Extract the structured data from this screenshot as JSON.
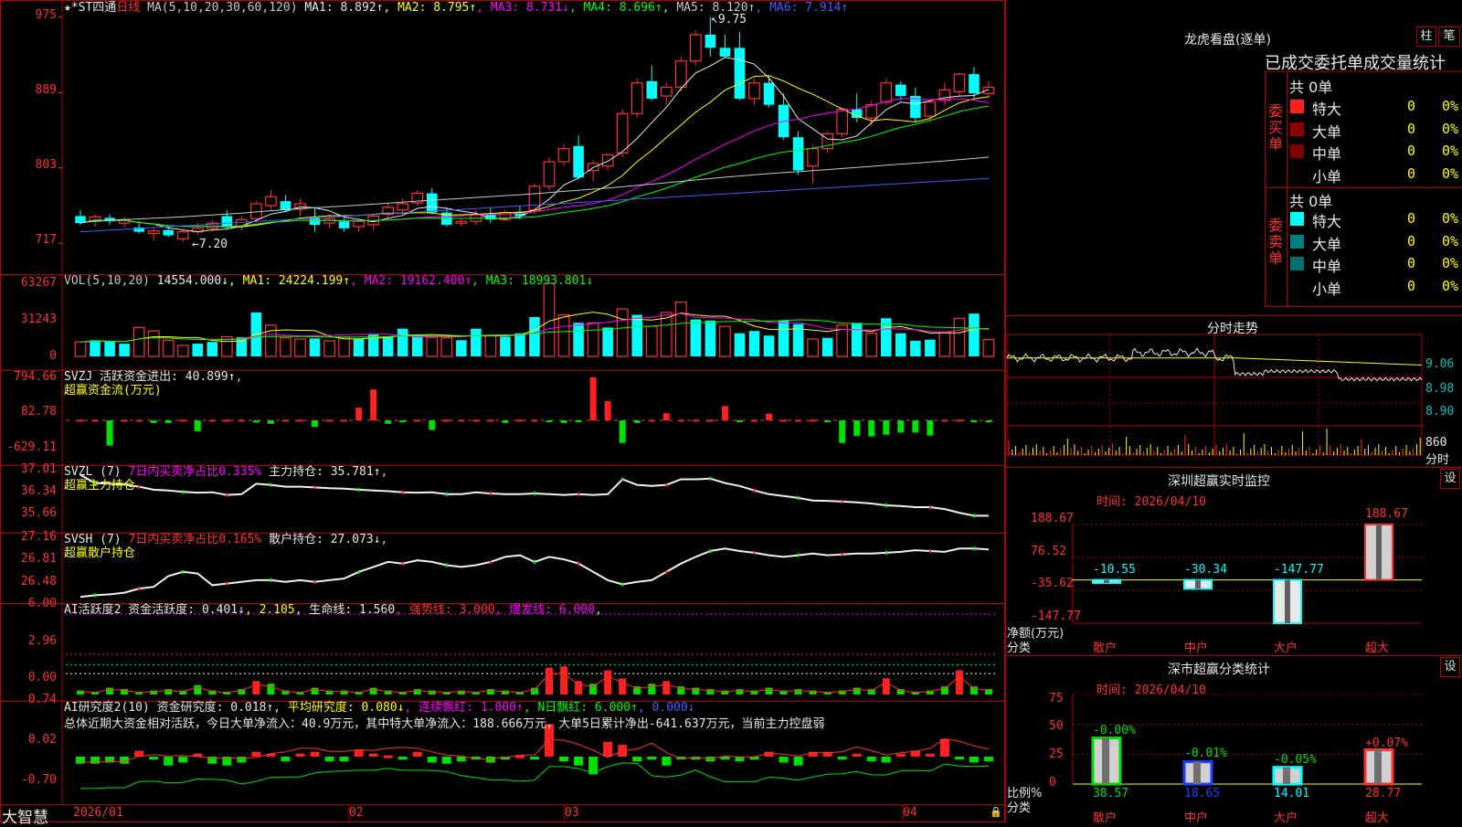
{
  "colors": {
    "up": "#ff3232",
    "down": "#00ffff",
    "border": "#b00000"
  },
  "price_panel": {
    "header": [
      {
        "t": "★*ST四通",
        "c": "#e8e8e8"
      },
      {
        "t": "日线",
        "c": "#ff3030"
      },
      {
        "t": " MA(5,10,20,30,60,120) ",
        "c": "#c8c8c8"
      },
      {
        "t": "MA1: 8.892↑",
        "c": "#e8e8e8"
      },
      {
        "t": ", MA2: 8.795↑",
        "c": "#ffff00"
      },
      {
        "t": ", MA3: 8.731↓",
        "c": "#ff00ff"
      },
      {
        "t": ", MA4: 8.696↑",
        "c": "#00ff00"
      },
      {
        "t": ", MA5: 8.120↑",
        "c": "#c8c8c8"
      },
      {
        "t": ", MA6: 7.914↑",
        "c": "#4060ff"
      }
    ],
    "y_labels": [
      "975",
      "889",
      "803",
      "717"
    ],
    "annot_high": "9.75",
    "annot_low": "7.20"
  },
  "vol_panel": {
    "header": [
      {
        "t": "VOL(5,10,20) ",
        "c": "#c8c8c8"
      },
      {
        "t": "14554.000↓",
        "c": "#e8e8e8"
      },
      {
        "t": ", MA1: 24224.199↑",
        "c": "#ffff00"
      },
      {
        "t": ", MA2: 19162.400↑",
        "c": "#ff00ff"
      },
      {
        "t": ", MA3: 18993.801↓",
        "c": "#00ff00"
      }
    ],
    "y_labels": [
      "63267",
      "31243",
      "0"
    ]
  },
  "svzj_panel": {
    "header": [
      {
        "t": "SVZJ  活跃资金进出: 40.899↑",
        "c": "#e8e8e8"
      },
      {
        "t": ",",
        "c": "#c8c8c8"
      }
    ],
    "subtitle": "超赢资金流(万元)",
    "y_labels": [
      "794.66",
      "82.78",
      "-629.11"
    ]
  },
  "svzl_panel": {
    "header": [
      {
        "t": "SVZL (7) ",
        "c": "#e8e8e8"
      },
      {
        "t": "7日内买卖净占比0.335%",
        "c": "#ff00ff"
      },
      {
        "t": " 主力持仓: 35.781↑",
        "c": "#e8e8e8"
      },
      {
        "t": ",",
        "c": "#c8c8c8"
      }
    ],
    "subtitle": "超赢主力持仓",
    "y_labels": [
      "37.01",
      "36.34",
      "35.66"
    ]
  },
  "svsh_panel": {
    "header": [
      {
        "t": "SVSH (7) ",
        "c": "#e8e8e8"
      },
      {
        "t": "7日内买卖净占比0.165%",
        "c": "#ff3030"
      },
      {
        "t": " 散户持仓: 27.073↓",
        "c": "#e8e8e8"
      },
      {
        "t": ",",
        "c": "#c8c8c8"
      }
    ],
    "subtitle": "超赢散户持仓",
    "y_labels": [
      "27.16",
      "26.81",
      "26.48"
    ]
  },
  "ai_active_panel": {
    "header": [
      {
        "t": "AI活跃度2 资金活跃度: 0.401↓",
        "c": "#e8e8e8"
      },
      {
        "t": ", 2.105",
        "c": "#ffff00"
      },
      {
        "t": ", 生命线: 1.560",
        "c": "#e8e8e8"
      },
      {
        "t": ", 强势线: 3.000",
        "c": "#ff3030"
      },
      {
        "t": ", 爆发线: 6.000",
        "c": "#ff00ff"
      },
      {
        "t": ",",
        "c": "#c8c8c8"
      }
    ],
    "y_labels": [
      "6.00",
      "2.96",
      "0.00"
    ]
  },
  "ai_research_panel": {
    "header": [
      {
        "t": "AI研究度2(10) 资金研究度: 0.018↑",
        "c": "#e8e8e8"
      },
      {
        "t": ", 平均研究度: 0.080↓",
        "c": "#ffff00"
      },
      {
        "t": ", 连续飘红: 1.000↑",
        "c": "#ff00ff"
      },
      {
        "t": ", N日飘红: 6.000↑",
        "c": "#00ff00"
      },
      {
        "t": ", 0.000↓",
        "c": "#4060ff"
      }
    ],
    "summary": "总体近期大资金相对活跃，今日大单净流入：40.9万元，其中特大单净流入：188.666万元，大单5日累计净出-641.637万元，当前主力控盘弱",
    "y_labels": [
      "0.74",
      "0.02",
      "-0.70"
    ]
  },
  "bottom_bar": {
    "brand": "大智慧",
    "dates": [
      "2026/01",
      "02",
      "03",
      "04"
    ]
  },
  "side": {
    "lhb_title": "龙虎看盘(逐单)",
    "btn_zhu": "柱",
    "btn_bi": "笔",
    "stat_header": "已成交委托单成交量统计",
    "buy_label": "委买单",
    "sell_label": "委卖单",
    "buy_total": "共 0单",
    "sell_total": "共 0单",
    "buy_rows": [
      {
        "name": "特大",
        "n": "0",
        "p": "0%",
        "c": "#ff2020"
      },
      {
        "name": "大单",
        "n": "0",
        "p": "0%",
        "c": "#900000"
      },
      {
        "name": "中单",
        "n": "0",
        "p": "0%",
        "c": "#800000"
      },
      {
        "name": "小单",
        "n": "0",
        "p": "0%",
        "c": "#000000"
      }
    ],
    "sell_rows": [
      {
        "name": "特大",
        "n": "0",
        "p": "0%",
        "c": "#00ffff"
      },
      {
        "name": "大单",
        "n": "0",
        "p": "0%",
        "c": "#008080"
      },
      {
        "name": "中单",
        "n": "0",
        "p": "0%",
        "c": "#007070"
      },
      {
        "name": "小单",
        "n": "0",
        "p": "0%",
        "c": "#000000"
      }
    ],
    "intraday_title": "分时走势",
    "intraday_y": [
      "9.06",
      "8.98",
      "8.90"
    ],
    "intraday_vol_y": [
      "860",
      "分时"
    ],
    "sz_title": "深圳超赢实时监控",
    "sz_time": "时间: 2026/04/10",
    "sz_btn": "设",
    "sz_y": [
      "188.67",
      "76.52",
      "-35.62",
      "-147.77"
    ],
    "sz_unit_1": "净额(万元)",
    "sz_unit_2": "分类",
    "sz_cats": [
      "散户",
      "中户",
      "大户",
      "超大"
    ],
    "sz_values": [
      "-10.55",
      "-30.34",
      "-147.77",
      "188.67"
    ],
    "cls_title": "深市超赢分类统计",
    "cls_time": "时间: 2026/04/10",
    "cls_btn": "设",
    "cls_y": [
      "75",
      "50",
      "25",
      "0"
    ],
    "cls_unit_1": "比例%",
    "cls_unit_2": "分类",
    "cls_cats": [
      "散户",
      "中户",
      "大户",
      "超大"
    ],
    "cls_top": [
      "-0.00%",
      "-0.01%",
      "-0.05%",
      "+0.07%"
    ],
    "cls_bottom": [
      "38.57",
      "18.65",
      "14.01",
      "28.77"
    ]
  },
  "chart_data": {
    "type": "candlestick",
    "title": "★*ST四通 日线",
    "x_labels": [
      "2026/01",
      "02",
      "03",
      "04"
    ],
    "ylim": [
      7.13,
      9.8
    ],
    "ohlc": [
      [
        7.48,
        7.55,
        7.38,
        7.4
      ],
      [
        7.42,
        7.5,
        7.36,
        7.47
      ],
      [
        7.46,
        7.5,
        7.38,
        7.42
      ],
      [
        7.4,
        7.47,
        7.35,
        7.44
      ],
      [
        7.35,
        7.42,
        7.28,
        7.3
      ],
      [
        7.28,
        7.34,
        7.2,
        7.31
      ],
      [
        7.32,
        7.36,
        7.24,
        7.26
      ],
      [
        7.22,
        7.32,
        7.18,
        7.3
      ],
      [
        7.3,
        7.4,
        7.26,
        7.34
      ],
      [
        7.34,
        7.44,
        7.3,
        7.4
      ],
      [
        7.48,
        7.55,
        7.33,
        7.35
      ],
      [
        7.36,
        7.48,
        7.32,
        7.44
      ],
      [
        7.45,
        7.65,
        7.42,
        7.62
      ],
      [
        7.6,
        7.78,
        7.55,
        7.7
      ],
      [
        7.65,
        7.72,
        7.52,
        7.55
      ],
      [
        7.56,
        7.68,
        7.48,
        7.62
      ],
      [
        7.46,
        7.58,
        7.3,
        7.38
      ],
      [
        7.4,
        7.5,
        7.34,
        7.45
      ],
      [
        7.42,
        7.48,
        7.3,
        7.34
      ],
      [
        7.36,
        7.45,
        7.3,
        7.42
      ],
      [
        7.38,
        7.5,
        7.32,
        7.48
      ],
      [
        7.5,
        7.62,
        7.46,
        7.58
      ],
      [
        7.55,
        7.68,
        7.5,
        7.62
      ],
      [
        7.63,
        7.78,
        7.6,
        7.74
      ],
      [
        7.74,
        7.8,
        7.5,
        7.52
      ],
      [
        7.52,
        7.58,
        7.36,
        7.38
      ],
      [
        7.4,
        7.45,
        7.36,
        7.42
      ],
      [
        7.42,
        7.55,
        7.38,
        7.5
      ],
      [
        7.5,
        7.58,
        7.4,
        7.44
      ],
      [
        7.44,
        7.55,
        7.42,
        7.52
      ],
      [
        7.53,
        7.6,
        7.44,
        7.48
      ],
      [
        7.55,
        7.85,
        7.5,
        7.82
      ],
      [
        7.82,
        8.15,
        7.78,
        8.1
      ],
      [
        8.1,
        8.3,
        8.05,
        8.25
      ],
      [
        8.28,
        8.4,
        7.9,
        7.92
      ],
      [
        8.0,
        8.12,
        7.88,
        8.08
      ],
      [
        8.05,
        8.2,
        8.0,
        8.18
      ],
      [
        8.2,
        8.7,
        8.15,
        8.65
      ],
      [
        8.65,
        9.05,
        8.6,
        9.0
      ],
      [
        9.02,
        9.2,
        8.8,
        8.82
      ],
      [
        8.85,
        9.0,
        8.75,
        8.95
      ],
      [
        8.95,
        9.3,
        8.9,
        9.25
      ],
      [
        9.25,
        9.6,
        9.2,
        9.55
      ],
      [
        9.55,
        9.75,
        9.3,
        9.4
      ],
      [
        9.4,
        9.55,
        9.28,
        9.3
      ],
      [
        9.4,
        9.58,
        8.8,
        8.82
      ],
      [
        8.82,
        9.05,
        8.75,
        9.0
      ],
      [
        9.0,
        9.08,
        8.72,
        8.75
      ],
      [
        8.75,
        8.88,
        8.35,
        8.38
      ],
      [
        8.38,
        8.45,
        7.95,
        8.0
      ],
      [
        8.05,
        8.3,
        7.85,
        8.25
      ],
      [
        8.25,
        8.45,
        8.2,
        8.42
      ],
      [
        8.42,
        8.72,
        8.38,
        8.7
      ],
      [
        8.7,
        8.88,
        8.55,
        8.6
      ],
      [
        8.6,
        8.8,
        8.5,
        8.75
      ],
      [
        8.78,
        9.05,
        8.75,
        9.0
      ],
      [
        8.98,
        9.02,
        8.8,
        8.85
      ],
      [
        8.85,
        8.95,
        8.55,
        8.6
      ],
      [
        8.62,
        8.8,
        8.55,
        8.78
      ],
      [
        8.8,
        9.0,
        8.75,
        8.92
      ],
      [
        8.9,
        9.12,
        8.85,
        9.1
      ],
      [
        9.1,
        9.18,
        8.82,
        8.88
      ],
      [
        8.88,
        9.02,
        8.82,
        8.95
      ]
    ],
    "volume": [
      [
        12500,
        1
      ],
      [
        14000,
        0
      ],
      [
        13000,
        0
      ],
      [
        11000,
        0
      ],
      [
        25000,
        1
      ],
      [
        22000,
        1
      ],
      [
        14000,
        1
      ],
      [
        9500,
        1
      ],
      [
        11000,
        0
      ],
      [
        12500,
        0
      ],
      [
        17000,
        1
      ],
      [
        16500,
        0
      ],
      [
        38000,
        0
      ],
      [
        27000,
        1
      ],
      [
        16000,
        1
      ],
      [
        15000,
        1
      ],
      [
        15500,
        0
      ],
      [
        13500,
        1
      ],
      [
        16500,
        1
      ],
      [
        15000,
        0
      ],
      [
        19000,
        0
      ],
      [
        17000,
        0
      ],
      [
        24000,
        0
      ],
      [
        18000,
        0
      ],
      [
        16500,
        1
      ],
      [
        16000,
        1
      ],
      [
        14000,
        0
      ],
      [
        24000,
        0
      ],
      [
        18000,
        1
      ],
      [
        17000,
        0
      ],
      [
        20000,
        0
      ],
      [
        34000,
        0
      ],
      [
        63267,
        1
      ],
      [
        36000,
        1
      ],
      [
        29000,
        0
      ],
      [
        29000,
        1
      ],
      [
        25000,
        0
      ],
      [
        41000,
        1
      ],
      [
        36000,
        0
      ],
      [
        26000,
        1
      ],
      [
        38000,
        1
      ],
      [
        47000,
        1
      ],
      [
        32000,
        0
      ],
      [
        31000,
        0
      ],
      [
        26000,
        1
      ],
      [
        20000,
        0
      ],
      [
        22000,
        0
      ],
      [
        18000,
        0
      ],
      [
        31000,
        0
      ],
      [
        28000,
        0
      ],
      [
        15000,
        1
      ],
      [
        16000,
        0
      ],
      [
        27000,
        1
      ],
      [
        29000,
        0
      ],
      [
        20000,
        1
      ],
      [
        33000,
        0
      ],
      [
        20000,
        0
      ],
      [
        13500,
        0
      ],
      [
        14500,
        0
      ],
      [
        21000,
        1
      ],
      [
        33000,
        1
      ],
      [
        37000,
        0
      ],
      [
        14554,
        1
      ]
    ],
    "svzj": [
      10,
      10,
      -580,
      10,
      10,
      -60,
      -60,
      10,
      -250,
      10,
      10,
      10,
      -50,
      -80,
      10,
      10,
      -150,
      10,
      10,
      230,
      560,
      -80,
      -30,
      10,
      -220,
      10,
      10,
      10,
      10,
      -60,
      10,
      10,
      -35,
      -60,
      -40,
      780,
      350,
      -520,
      -60,
      10,
      130,
      10,
      10,
      10,
      260,
      -30,
      10,
      120,
      10,
      10,
      10,
      -35,
      -520,
      -360,
      -370,
      -330,
      -280,
      -280,
      -350,
      10,
      10,
      -40,
      -45
    ],
    "svzl": [
      37.02,
      36.8,
      36.78,
      36.76,
      36.7,
      36.62,
      36.6,
      36.56,
      36.54,
      36.55,
      36.48,
      36.5,
      36.78,
      36.75,
      36.7,
      36.7,
      36.68,
      36.66,
      36.65,
      36.62,
      36.6,
      36.58,
      36.55,
      36.54,
      36.55,
      36.5,
      36.5,
      36.55,
      36.52,
      36.5,
      36.5,
      36.52,
      36.5,
      36.48,
      36.5,
      36.48,
      36.5,
      36.9,
      36.75,
      36.72,
      36.75,
      36.9,
      36.9,
      36.92,
      36.8,
      36.72,
      36.6,
      36.5,
      36.45,
      36.4,
      36.33,
      36.32,
      36.3,
      36.28,
      36.25,
      36.2,
      36.18,
      36.15,
      36.15,
      36.1,
      36.0,
      35.92,
      35.92
    ],
    "svsh": [
      26.5,
      26.52,
      26.53,
      26.55,
      26.6,
      26.62,
      26.75,
      26.8,
      26.78,
      26.64,
      26.66,
      26.68,
      26.7,
      26.7,
      26.68,
      26.7,
      26.68,
      26.7,
      26.72,
      26.8,
      26.86,
      26.92,
      26.9,
      26.94,
      26.92,
      26.88,
      26.86,
      26.88,
      26.92,
      26.98,
      27.0,
      26.92,
      26.98,
      26.95,
      26.9,
      26.8,
      26.7,
      26.65,
      26.68,
      26.7,
      26.8,
      26.9,
      26.98,
      27.05,
      27.08,
      27.05,
      27.03,
      27.0,
      26.98,
      27.0,
      27.02,
      27.0,
      27.01,
      27.02,
      27.02,
      27.03,
      27.04,
      27.06,
      27.05,
      27.04,
      27.08,
      27.08,
      27.07
    ],
    "ai_active": [
      0.3,
      0.2,
      0.5,
      0.4,
      0.2,
      0.3,
      0.4,
      0.3,
      0.7,
      0.3,
      0.2,
      0.4,
      1.0,
      0.8,
      0.3,
      0.2,
      0.5,
      0.3,
      0.3,
      0.2,
      0.5,
      0.3,
      0.2,
      0.4,
      0.3,
      0.2,
      0.3,
      0.2,
      0.4,
      0.3,
      0.2,
      0.5,
      2.0,
      2.1,
      1.0,
      0.8,
      1.8,
      1.2,
      0.6,
      0.8,
      1.0,
      0.6,
      0.5,
      0.4,
      0.3,
      0.4,
      0.3,
      0.5,
      0.3,
      0.4,
      0.3,
      0.2,
      0.3,
      0.5,
      0.4,
      1.2,
      0.4,
      0.2,
      0.3,
      0.6,
      1.8,
      0.6,
      0.4
    ],
    "ai_research": [
      -0.12,
      -0.12,
      -0.1,
      -0.12,
      0.1,
      -0.05,
      -0.15,
      -0.1,
      0.05,
      -0.12,
      -0.15,
      -0.1,
      0.08,
      0.05,
      -0.08,
      0.05,
      0.08,
      -0.08,
      -0.08,
      0.12,
      0.05,
      0.02,
      -0.05,
      0.08,
      -0.1,
      -0.12,
      -0.08,
      -0.05,
      -0.1,
      -0.05,
      0.02,
      -0.05,
      0.55,
      -0.08,
      -0.15,
      -0.3,
      0.25,
      0.2,
      -0.08,
      -0.05,
      -0.15,
      -0.05,
      -0.05,
      -0.08,
      -0.05,
      -0.08,
      -0.05,
      0.08,
      -0.1,
      -0.15,
      0.08,
      0.08,
      -0.05,
      0.05,
      -0.08,
      -0.1,
      0.05,
      0.1,
      0.05,
      0.3,
      -0.05,
      -0.1,
      -0.08
    ],
    "intraday_y_range": [
      8.86,
      9.1
    ],
    "monitor_net": [
      -10.55,
      -30.34,
      -147.77,
      188.67
    ],
    "class_pct": [
      38.57,
      18.65,
      14.01,
      28.77
    ]
  }
}
